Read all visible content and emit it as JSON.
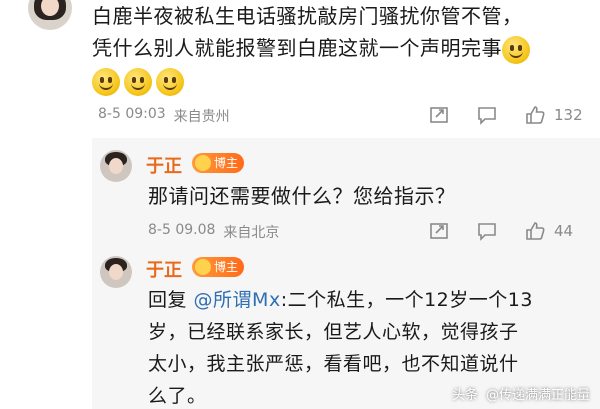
{
  "top_comment": {
    "text_line1": "白鹿半夜被私生电话骚扰敲房门骚扰你管不管，",
    "text_line2": "凭什么别人就能报警到白鹿这就一个声明完事",
    "emoji_count_inline": 1,
    "emoji_count_line3": 3,
    "date": "8-5 09:03",
    "location": "来自贵州",
    "like_count": "132"
  },
  "replies": [
    {
      "name": "于正",
      "badge": "博主",
      "text": "那请问还需要做什么？您给指示？",
      "date": "8-5 09.08",
      "location": "来自北京",
      "like_count": "44"
    },
    {
      "name": "于正",
      "badge": "博主",
      "reply_prefix": "回复 ",
      "mention": "@所谓Mx",
      "text_line1": ":二个私生，一个12岁一个13",
      "text_line2": "岁，已经联系家长，但艺人心软，觉得孩子",
      "text_line3": "太小，我主张严惩，看看吧，也不知道说什",
      "text_line4": "么了。"
    }
  ],
  "watermark": {
    "platform": "头条",
    "account": "@传递满满正能量"
  }
}
